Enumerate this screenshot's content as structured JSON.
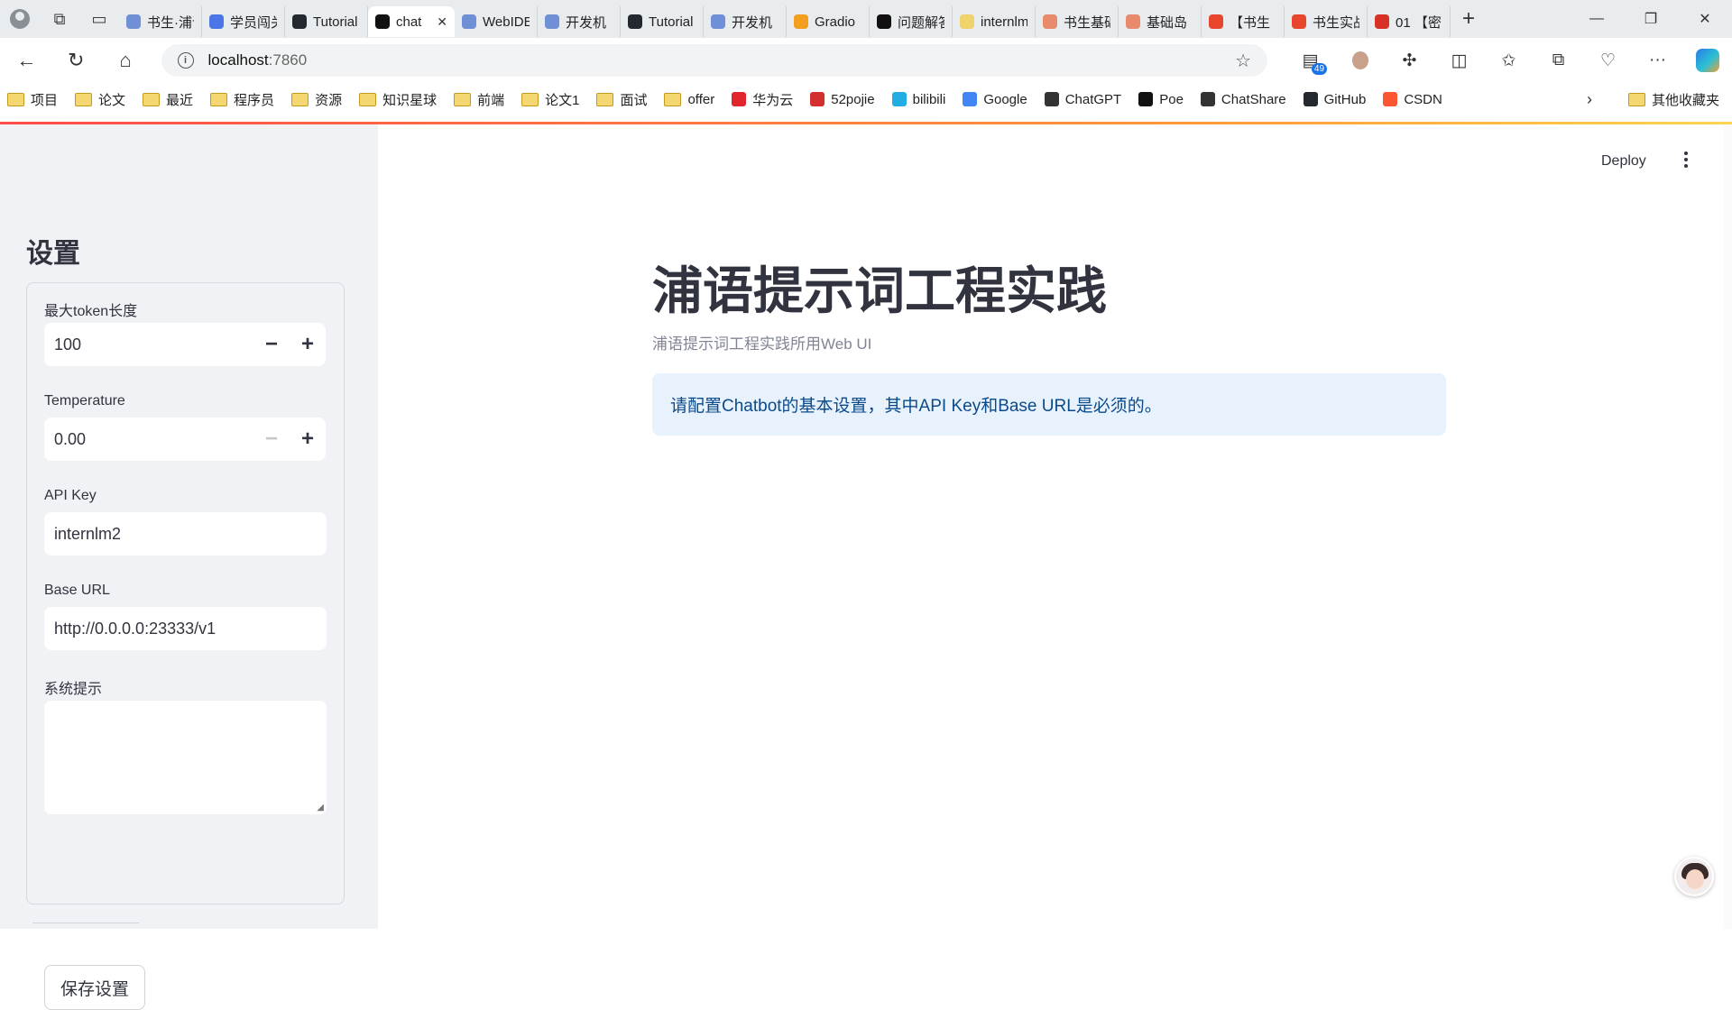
{
  "browser": {
    "tabs": [
      {
        "title": "书生·浦语",
        "favicon_color": "#6f8fd6"
      },
      {
        "title": "学员闯关",
        "favicon_color": "#4a76e8"
      },
      {
        "title": "Tutorial",
        "favicon_color": "#24292f"
      },
      {
        "title": "chat",
        "favicon_color": "#111111",
        "active": true
      },
      {
        "title": "WebIDE",
        "favicon_color": "#6f8fd6"
      },
      {
        "title": "开发机",
        "favicon_color": "#6f8fd6"
      },
      {
        "title": "Tutorial",
        "favicon_color": "#24292f"
      },
      {
        "title": "开发机",
        "favicon_color": "#6f8fd6"
      },
      {
        "title": "Gradio",
        "favicon_color": "#f29f1d"
      },
      {
        "title": "问题解答",
        "favicon_color": "#111111"
      },
      {
        "title": "internlm",
        "favicon_color": "#f0d36a"
      },
      {
        "title": "书生基础",
        "favicon_color": "#e88b6d"
      },
      {
        "title": "基础岛",
        "favicon_color": "#e88b6d"
      },
      {
        "title": "【书生",
        "favicon_color": "#e8452c"
      },
      {
        "title": "书生实战",
        "favicon_color": "#e8452c"
      },
      {
        "title": "01 【密",
        "favicon_color": "#d93025"
      }
    ],
    "url_host": "localhost",
    "url_port": ":7860",
    "badge_count": "49",
    "bookmarks": [
      {
        "label": "项目",
        "type": "folder"
      },
      {
        "label": "论文",
        "type": "folder"
      },
      {
        "label": "最近",
        "type": "folder"
      },
      {
        "label": "程序员",
        "type": "folder"
      },
      {
        "label": "资源",
        "type": "folder"
      },
      {
        "label": "知识星球",
        "type": "folder"
      },
      {
        "label": "前端",
        "type": "folder"
      },
      {
        "label": "论文1",
        "type": "folder"
      },
      {
        "label": "面试",
        "type": "folder"
      },
      {
        "label": "offer",
        "type": "folder"
      },
      {
        "label": "华为云",
        "type": "site",
        "icon_color": "#e0252c"
      },
      {
        "label": "52pojie",
        "type": "site",
        "icon_color": "#d32f2f"
      },
      {
        "label": "bilibili",
        "type": "site",
        "icon_color": "#23ade5"
      },
      {
        "label": "Google",
        "type": "site",
        "icon_color": "#4285f4"
      },
      {
        "label": "ChatGPT",
        "type": "site",
        "icon_color": "#333333"
      },
      {
        "label": "Poe",
        "type": "site",
        "icon_color": "#111111"
      },
      {
        "label": "ChatShare",
        "type": "site",
        "icon_color": "#333333"
      },
      {
        "label": "GitHub",
        "type": "site",
        "icon_color": "#24292f"
      },
      {
        "label": "CSDN",
        "type": "site",
        "icon_color": "#fc5531"
      }
    ],
    "other_bookmarks": "其他收藏夹"
  },
  "sidebar": {
    "title": "设置",
    "max_tokens": {
      "label": "最大token长度",
      "value": "100"
    },
    "temperature": {
      "label": "Temperature",
      "value": "0.00"
    },
    "api_key": {
      "label": "API Key",
      "value": "internlm2"
    },
    "base_url": {
      "label": "Base URL",
      "value": "http://0.0.0.0:23333/v1"
    },
    "system_prompt": {
      "label": "系统提示",
      "value": ""
    },
    "save_label": "保存设置"
  },
  "main": {
    "deploy_label": "Deploy",
    "title": "浦语提示词工程实践",
    "caption": "浦语提示词工程实践所用Web UI",
    "info": "请配置Chatbot的基本设置，其中API Key和Base URL是必须的。"
  },
  "colors": {
    "sidebar_bg": "#f0f2f6",
    "info_bg": "#e8f2fc",
    "info_text": "#0b4a8a",
    "accent": "#ff4b4b"
  }
}
